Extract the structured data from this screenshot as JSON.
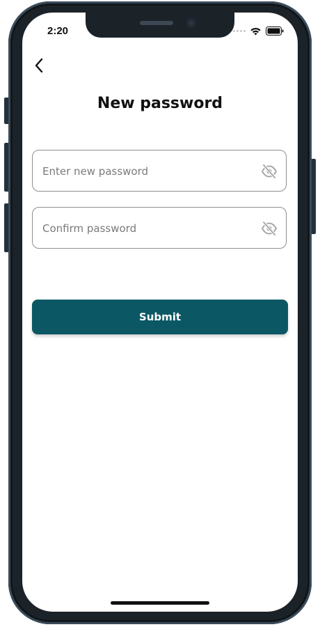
{
  "status_bar": {
    "time": "2:20",
    "icons": [
      "signal-icon",
      "wifi-icon",
      "battery-icon"
    ]
  },
  "header": {
    "back_icon": "chevron-left-icon",
    "title": "New password"
  },
  "form": {
    "new_password": {
      "placeholder": "Enter new password",
      "value": "",
      "toggle_icon": "eye-off-icon"
    },
    "confirm_password": {
      "placeholder": "Confirm password",
      "value": "",
      "toggle_icon": "eye-off-icon"
    },
    "submit_label": "Submit"
  },
  "colors": {
    "primary": "#0b5764",
    "frame": "#1b2228",
    "field_border": "#8f8f8f",
    "icon_gray": "#a8a8a8"
  }
}
